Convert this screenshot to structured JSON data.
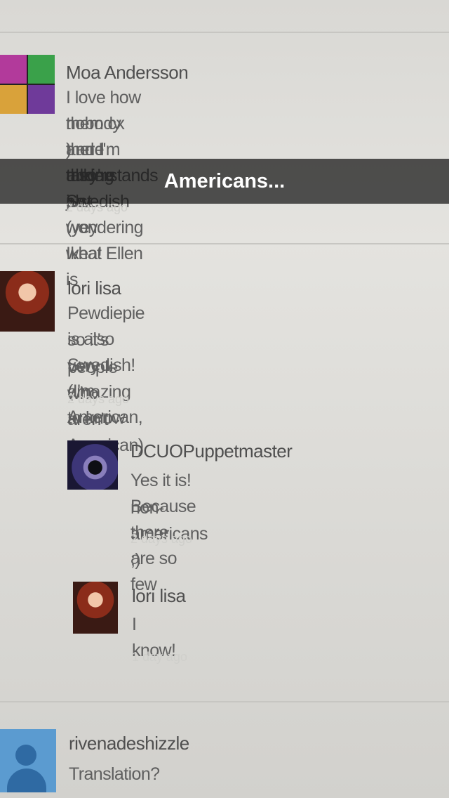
{
  "caption": "Americans...",
  "comments": [
    {
      "author": "Moa Andersson",
      "lines": [
        "I love how nobody there understands",
        "them cx and I'm also Swedish (yey Ikea!",
        ") and they're just wondering what Ellen is",
        "talking ab"
      ],
      "time": "2 days ago"
    },
    {
      "author": "lori lisa",
      "lines": [
        "Pewdiepie is also Swedish!(I'm American,",
        "so it's very amazing to know",
        "people who aren't American)"
      ],
      "time": "2 days ago",
      "replies": [
        {
          "author": "DCUOPuppetmaster",
          "lines": [
            "Yes it is! Because there are so few",
            "non-americans ;)"
          ],
          "time": "2 days ago"
        },
        {
          "author": "lori lisa",
          "lines": [
            "I know!"
          ],
          "time": "1 day ago"
        }
      ]
    },
    {
      "author": "rivenadeshizzle",
      "lines": [
        "Translation?"
      ]
    }
  ]
}
